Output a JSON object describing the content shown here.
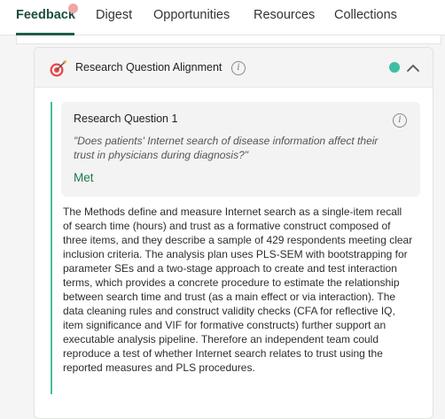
{
  "tabs": [
    {
      "label": "Feedback",
      "active": true
    },
    {
      "label": "Digest"
    },
    {
      "label": "Opportunities"
    },
    {
      "label": "Resources"
    },
    {
      "label": "Collections"
    }
  ],
  "panel": {
    "title": "Research Question Alignment",
    "icon": "target-arrow-icon",
    "status_color": "#3dbfa6",
    "expanded": true
  },
  "question": {
    "title": "Research Question 1",
    "text": "\"Does patients' Internet search of disease information affect their trust in physicians during diagnosis?\"",
    "status": "Met"
  },
  "analysis_text": "The Methods define and measure Internet search as a single-item recall of search time (hours) and trust as a formative construct composed of three items, and they describe a sample of 429 respondents meeting clear inclusion criteria. The analysis plan uses PLS-SEM with bootstrapping for parameter SEs and a two-stage approach to create and test interaction terms, which provides a concrete procedure to estimate the relationship between search time and trust (as a main effect or via interaction). The data cleaning rules and construct validity checks (CFA for reflective IQ, item significance and VIF for formative constructs) further support an executable analysis pipeline. Therefore an independent team could reproduce a test of whether Internet search relates to trust using the reported measures and PLS procedures.",
  "colors": {
    "accent": "#1f5c45",
    "met": "#1f7a4d",
    "border_accent": "#48c09e",
    "notification": "#f1a5a5"
  }
}
